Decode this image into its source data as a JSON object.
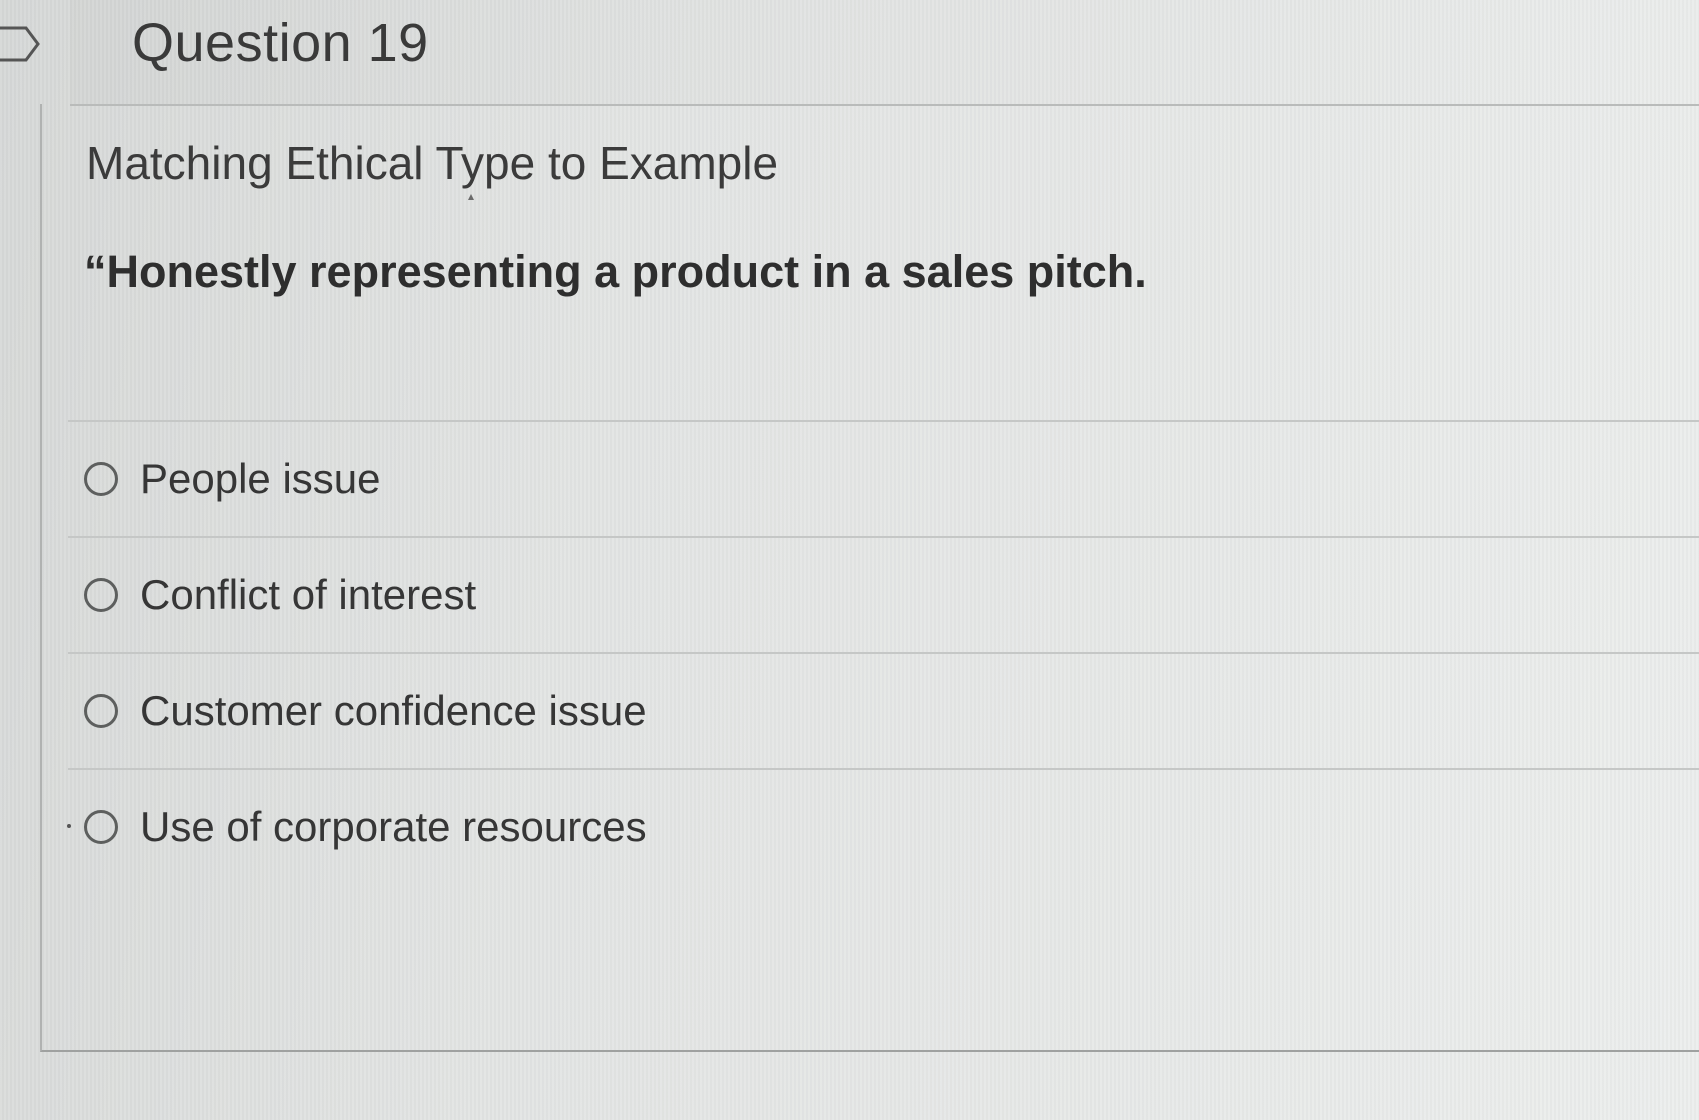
{
  "question": {
    "title": "Question 19",
    "heading": "Matching Ethical Type to Example",
    "prompt": "“Honestly representing a product in a sales pitch."
  },
  "answers": [
    {
      "label": "People issue",
      "selected": false
    },
    {
      "label": "Conflict of interest",
      "selected": false
    },
    {
      "label": "Customer confidence issue",
      "selected": false
    },
    {
      "label": "Use of corporate resources",
      "selected": false
    }
  ],
  "icons": {
    "flag": "flag-icon",
    "radio": "radio-button-icon"
  }
}
